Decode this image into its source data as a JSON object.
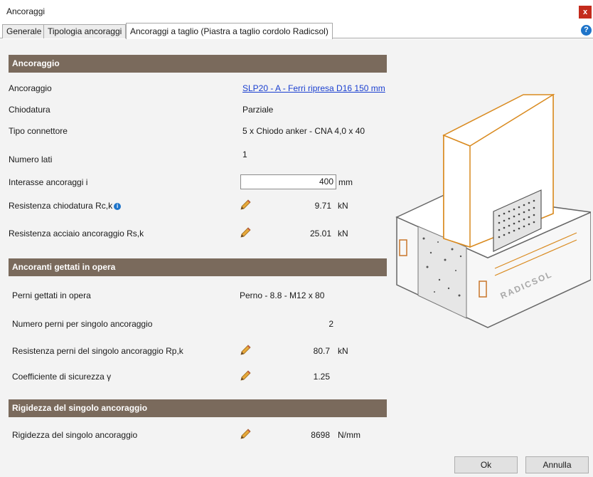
{
  "window": {
    "title": "Ancoraggi",
    "close_glyph": "x"
  },
  "tabs": [
    {
      "label": "Generale"
    },
    {
      "label": "Tipologia ancoraggi"
    },
    {
      "label": "Ancoraggi a taglio (Piastra a taglio cordolo Radicsol)"
    }
  ],
  "help_glyph": "?",
  "sections": {
    "ancoraggio": {
      "title": "Ancoraggio",
      "ancoraggio_label": "Ancoraggio",
      "ancoraggio_value": "SLP20 - A - Ferri ripresa D16 150 mm",
      "chiodatura_label": "Chiodatura",
      "chiodatura_value": "Parziale",
      "connettore_label": "Tipo connettore",
      "connettore_value": "5  x  Chiodo anker - CNA 4,0 x 40",
      "lati_label": "Numero lati",
      "lati_value": "1",
      "interasse_label": "Interasse ancoraggi i",
      "interasse_value": "400",
      "interasse_unit": "mm",
      "rck_label": "Resistenza chiodatura Rc,k",
      "rck_value": "9.71",
      "rck_unit": "kN",
      "rsk_label": "Resistenza acciaio ancoraggio Rs,k",
      "rsk_value": "25.01",
      "rsk_unit": "kN"
    },
    "ancoranti": {
      "title": "Ancoranti gettati in opera",
      "perni_label": "Perni gettati in opera",
      "perni_value": "Perno - 8.8 - M12 x 80",
      "numero_label": "Numero perni per singolo ancoraggio",
      "numero_value": "2",
      "rpk_label": "Resistenza perni del singolo ancoraggio Rp,k",
      "rpk_value": "80.7",
      "rpk_unit": "kN",
      "coeff_label": "Coefficiente di sicurezza γ",
      "coeff_value": "1.25"
    },
    "rigidezza": {
      "title": "Rigidezza del singolo ancoraggio",
      "label": "Rigidezza del singolo ancoraggio",
      "value": "8698",
      "unit": "N/mm"
    }
  },
  "illustration": {
    "brand": "RADICSOL"
  },
  "buttons": {
    "ok": "Ok",
    "cancel": "Annulla"
  },
  "colors": {
    "section_header": "#7a6a5c",
    "accent_orange": "#d98a1f",
    "link": "#1a3fd0"
  }
}
